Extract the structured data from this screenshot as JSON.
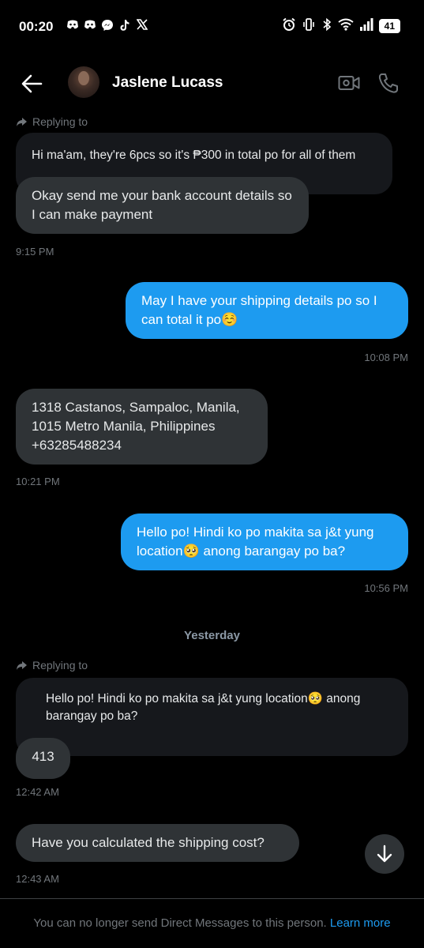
{
  "status_bar": {
    "time": "00:20",
    "battery": "41",
    "left_icons": [
      "discord-icon",
      "discord-icon",
      "messenger-icon",
      "tiktok-icon",
      "x-icon"
    ],
    "right_icons": [
      "alarm-icon",
      "vibrate-icon",
      "bluetooth-icon",
      "wifi-icon",
      "signal-icon",
      "battery-icon"
    ]
  },
  "header": {
    "contact_name": "Jaslene Lucass"
  },
  "messages": {
    "reply1_label": "Replying to",
    "reply1_quoted": "Hi ma'am, they're 6pcs so it's ₱300 in total po for all of them",
    "msg1": "Okay send me your bank account details so I can make payment",
    "msg1_time": "9:15 PM",
    "msg2": "May I have your shipping details po so I can total it po☺️",
    "msg2_time": "10:08 PM",
    "msg3": "1318 Castanos, Sampaloc, Manila, 1015 Metro Manila, Philippines +63285488234",
    "msg3_time": "10:21 PM",
    "msg4": "Hello po! Hindi ko po makita sa j&t yung location🥺 anong barangay po ba?",
    "msg4_time": "10:56 PM",
    "day_separator": "Yesterday",
    "reply2_label": "Replying to",
    "reply2_quoted": "Hello po! Hindi ko po makita sa j&t yung location🥺 anong barangay po ba?",
    "msg5": "413",
    "msg5_time": "12:42 AM",
    "msg6": "Have you calculated the shipping cost?",
    "msg6_time": "12:43 AM"
  },
  "footer": {
    "notice": "You can no longer send Direct Messages to this person.",
    "learn_more": "Learn more"
  },
  "colors": {
    "background": "#000000",
    "incoming_bubble": "#2f3336",
    "outgoing_bubble": "#1d9bf0",
    "link": "#1d9bf0",
    "muted_text": "#71767b"
  }
}
